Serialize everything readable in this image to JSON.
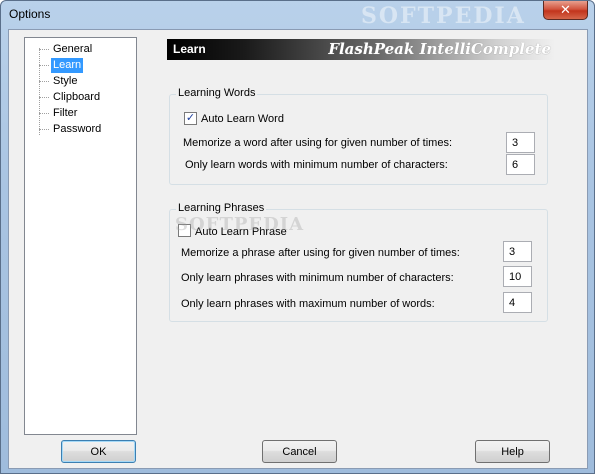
{
  "window": {
    "title": "Options",
    "watermark": "SOFTPEDIA",
    "close_glyph": "✕"
  },
  "tree": {
    "items": [
      {
        "label": "General",
        "selected": false
      },
      {
        "label": "Learn",
        "selected": true
      },
      {
        "label": "Style",
        "selected": false
      },
      {
        "label": "Clipboard",
        "selected": false
      },
      {
        "label": "Filter",
        "selected": false
      },
      {
        "label": "Password",
        "selected": false
      }
    ]
  },
  "header": {
    "title": "Learn",
    "brand": "FlashPeak IntelliComplete"
  },
  "learning_words": {
    "group_label": "Learning Words",
    "auto_learn_label": "Auto Learn Word",
    "auto_learn_checked": true,
    "memorize_label": "Memorize a word after using for given number of times:",
    "memorize_value": "3",
    "min_chars_label": "Only learn words with minimum number of characters:",
    "min_chars_value": "6"
  },
  "learning_phrases": {
    "group_label": "Learning Phrases",
    "auto_learn_label": "Auto Learn Phrase",
    "auto_learn_checked": false,
    "memorize_label": "Memorize a phrase after using for given number of times:",
    "memorize_value": "3",
    "min_chars_label": "Only learn phrases with minimum number of characters:",
    "min_chars_value": "10",
    "max_words_label": "Only learn phrases with maximum number of words:",
    "max_words_value": "4"
  },
  "buttons": {
    "ok": "OK",
    "cancel": "Cancel",
    "help": "Help"
  },
  "watermark_mid": "SOFTPEDIA"
}
